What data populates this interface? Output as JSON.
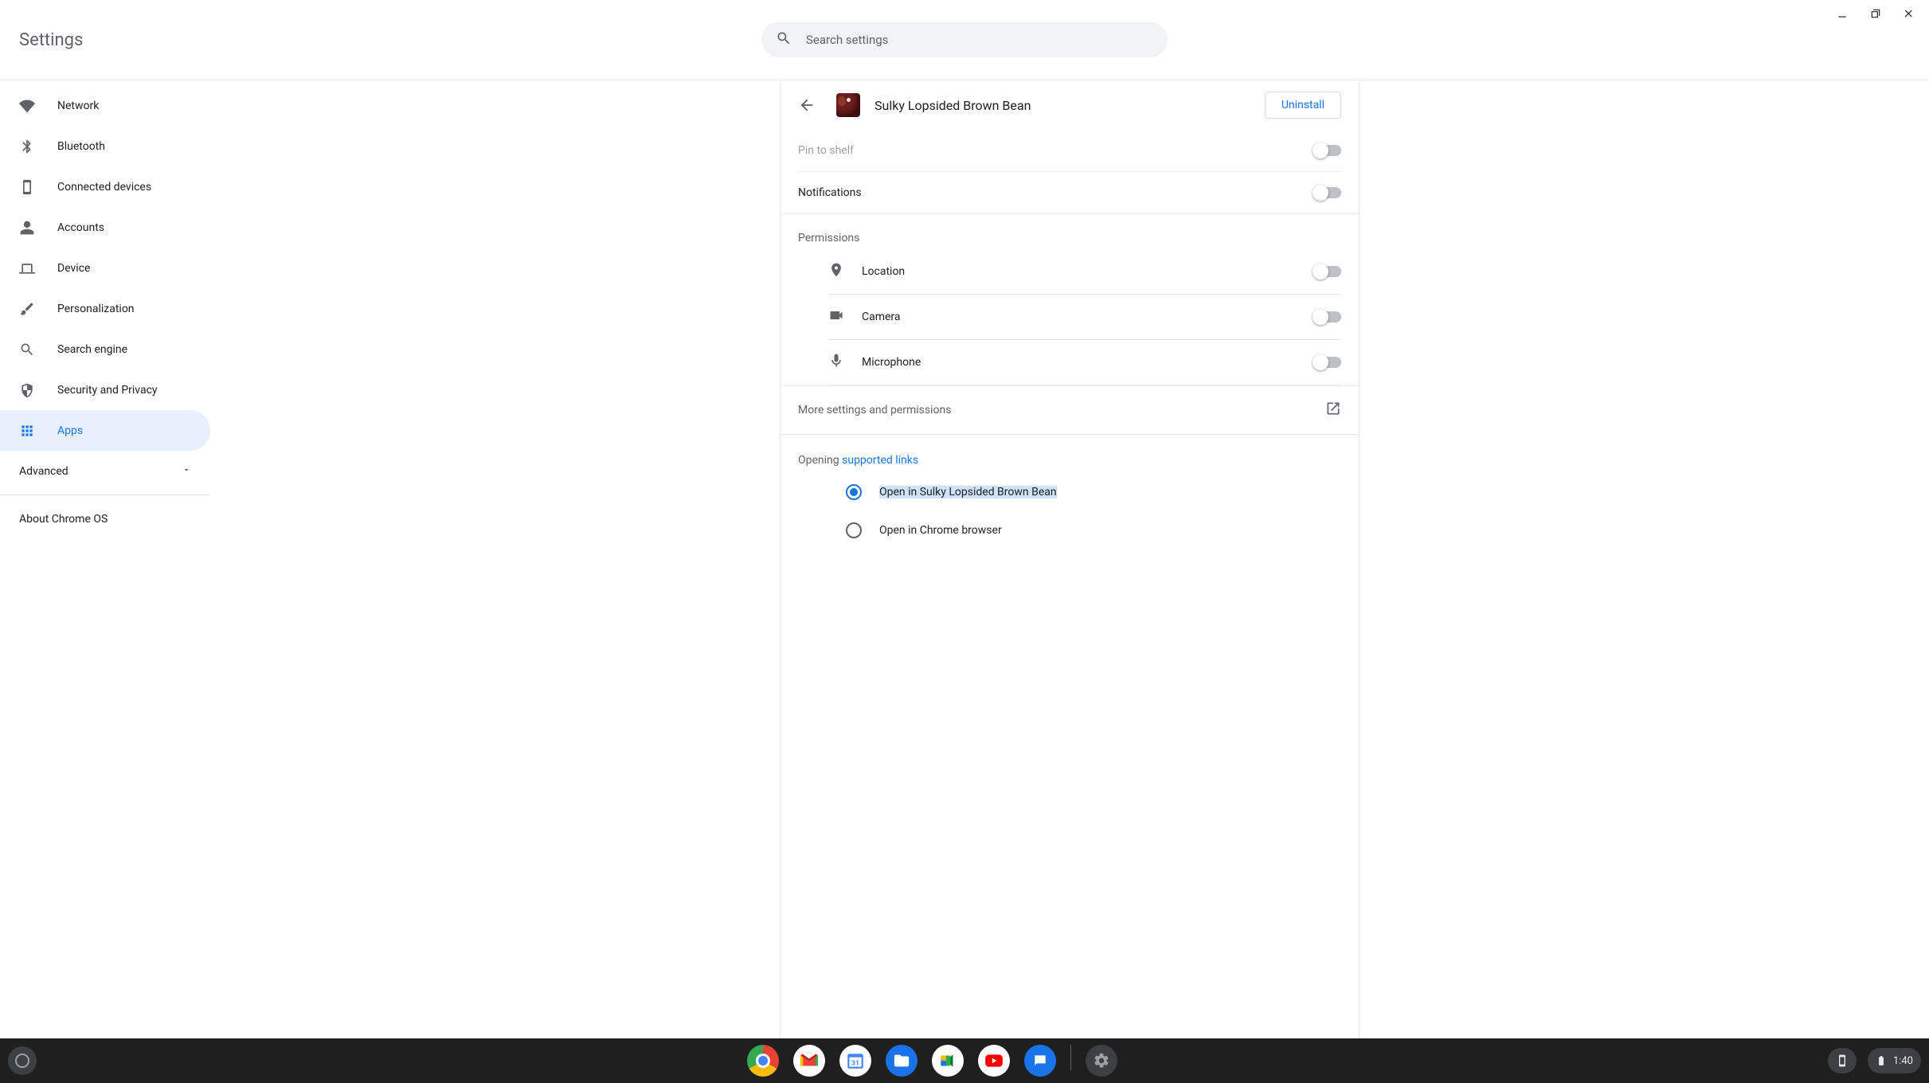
{
  "window": {
    "title": "Settings"
  },
  "search": {
    "placeholder": "Search settings"
  },
  "sidebar": {
    "items": [
      {
        "label": "Network",
        "icon": "wifi"
      },
      {
        "label": "Bluetooth",
        "icon": "bluetooth"
      },
      {
        "label": "Connected devices",
        "icon": "phone"
      },
      {
        "label": "Accounts",
        "icon": "person"
      },
      {
        "label": "Device",
        "icon": "laptop"
      },
      {
        "label": "Personalization",
        "icon": "brush"
      },
      {
        "label": "Search engine",
        "icon": "search"
      },
      {
        "label": "Security and Privacy",
        "icon": "shield"
      },
      {
        "label": "Apps",
        "icon": "apps",
        "active": true
      }
    ],
    "advanced": "Advanced",
    "about": "About Chrome OS"
  },
  "app": {
    "name": "Sulky Lopsided Brown Bean",
    "uninstall": "Uninstall",
    "pin_label": "Pin to shelf",
    "pin_state": false,
    "notif_label": "Notifications",
    "notif_state": false,
    "permissions_header": "Permissions",
    "permissions": [
      {
        "label": "Location",
        "state": false
      },
      {
        "label": "Camera",
        "state": false
      },
      {
        "label": "Microphone",
        "state": false
      }
    ],
    "more_label": "More settings and permissions",
    "opening_prefix": "Opening ",
    "opening_link": "supported links",
    "radio_options": [
      {
        "label": "Open in Sulky Lopsided Brown Bean",
        "selected": true
      },
      {
        "label": "Open in Chrome browser",
        "selected": false
      }
    ]
  },
  "shelf": {
    "time": "1:40",
    "apps": [
      "chrome",
      "gmail",
      "calendar",
      "files",
      "meet",
      "youtube",
      "messages",
      "settings"
    ]
  }
}
